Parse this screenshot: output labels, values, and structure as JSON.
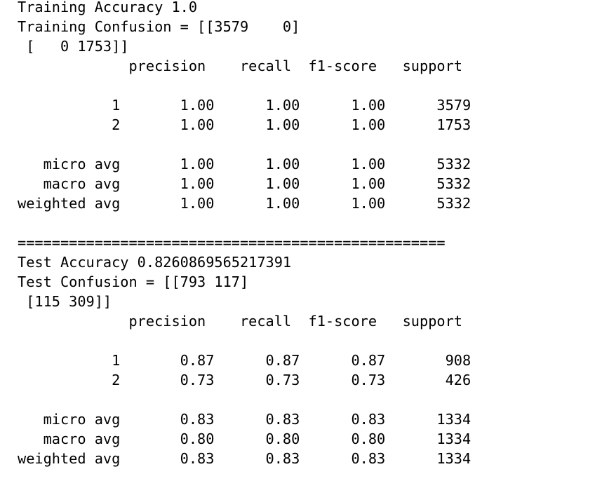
{
  "output": {
    "lines": [
      "Training Accuracy 1.0",
      "Training Confusion = [[3579    0]",
      " [   0 1753]]",
      "             precision    recall  f1-score   support",
      "",
      "           1       1.00      1.00      1.00      3579",
      "           2       1.00      1.00      1.00      1753",
      "",
      "   micro avg       1.00      1.00      1.00      5332",
      "   macro avg       1.00      1.00      1.00      5332",
      "weighted avg       1.00      1.00      1.00      5332",
      "",
      "==================================================",
      "Test Accuracy 0.8260869565217391",
      "Test Confusion = [[793 117]",
      " [115 309]]",
      "             precision    recall  f1-score   support",
      "",
      "           1       0.87      0.87      0.87       908",
      "           2       0.73      0.73      0.73       426",
      "",
      "   micro avg       0.83      0.83      0.83      1334",
      "   macro avg       0.80      0.80      0.80      1334",
      "weighted avg       0.83      0.83      0.83      1334"
    ]
  }
}
